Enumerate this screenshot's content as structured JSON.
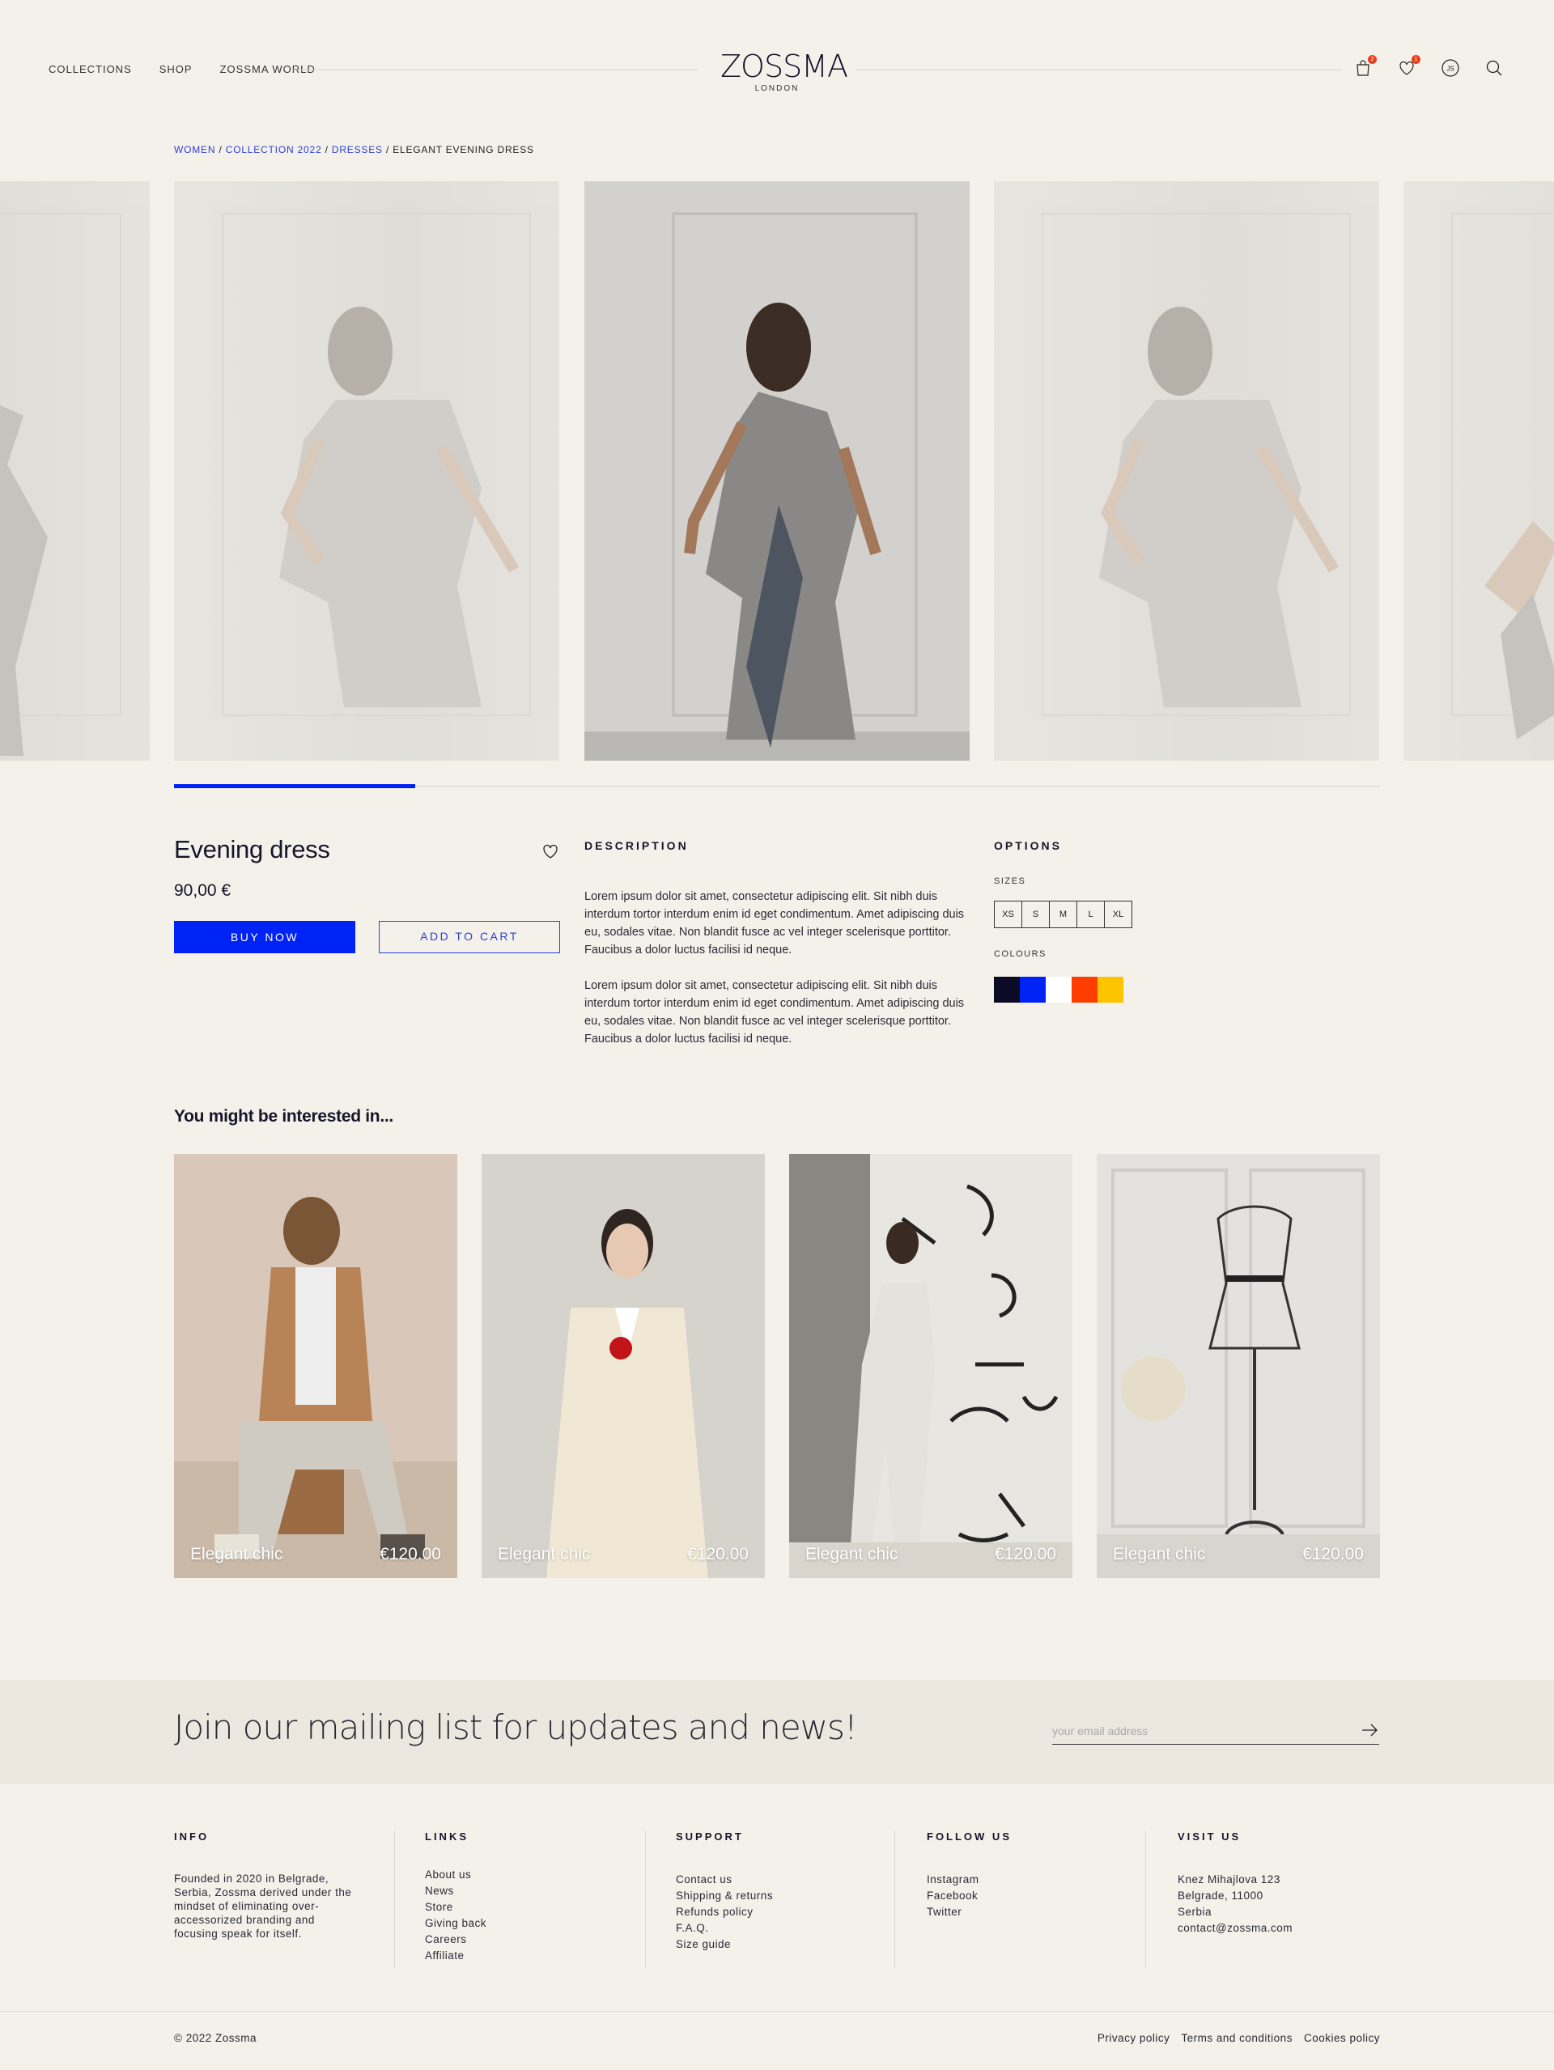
{
  "header": {
    "nav": [
      "COLLECTIONS",
      "SHOP",
      "ZOSSMA WORLD"
    ],
    "logo": {
      "name": "ZOSSMA",
      "city": "LONDON"
    },
    "cart_count": "2",
    "wishlist_count": "1",
    "avatar_initials": "JS"
  },
  "breadcrumb": {
    "women": "WOMEN",
    "collection": "COLLECTION 2022",
    "dresses": "DRESSES",
    "current": "ELEGANT EVENING DRESS",
    "sep": " / "
  },
  "gallery": {
    "progress": 0.2
  },
  "product": {
    "title": "Evening dress",
    "price": "90,00 €",
    "buy_label": "BUY NOW",
    "cart_label": "ADD TO CART"
  },
  "description": {
    "heading": "DESCRIPTION",
    "paragraphs": [
      "Lorem ipsum dolor sit amet, consectetur adipiscing elit. Sit nibh duis interdum tortor interdum enim id eget condimentum. Amet adipiscing duis eu, sodales vitae. Non blandit fusce ac vel integer scelerisque porttitor. Faucibus a dolor luctus facilisi id neque.",
      "Lorem ipsum dolor sit amet, consectetur adipiscing elit. Sit nibh duis interdum tortor interdum enim id eget condimentum. Amet adipiscing duis eu, sodales vitae. Non blandit fusce ac vel integer scelerisque porttitor. Faucibus a dolor luctus facilisi id neque."
    ]
  },
  "options": {
    "heading": "OPTIONS",
    "sizes_label": "SIZES",
    "sizes": [
      "XS",
      "S",
      "M",
      "L",
      "XL"
    ],
    "colours_label": "COLOURS",
    "colours": [
      "#0b0b26",
      "#0023f5",
      "#ffffff",
      "#ff3d00",
      "#ffc400"
    ]
  },
  "recommendations": {
    "title": "You might be interested in...",
    "items": [
      {
        "name": "Elegant chic",
        "price": "€120.00"
      },
      {
        "name": "Elegant chic",
        "price": "€120.00"
      },
      {
        "name": "Elegant chic",
        "price": "€120.00"
      },
      {
        "name": "Elegant chic",
        "price": "€120.00"
      }
    ]
  },
  "newsletter": {
    "heading": "Join our mailing list for updates and news!",
    "placeholder": "your email address"
  },
  "footer": {
    "info": {
      "heading": "INFO",
      "text": "Founded in 2020 in Belgrade, Serbia, Zossma derived under the mindset of eliminating over-accessorized branding and focusing speak for itself."
    },
    "links": {
      "heading": "LINKS",
      "items": [
        "About us",
        "News",
        "Store",
        "Giving back",
        "Careers",
        "Affiliate"
      ]
    },
    "support": {
      "heading": "SUPPORT",
      "items": [
        "Contact us",
        "Shipping & returns",
        "Refunds policy",
        "F.A.Q.",
        "Size guide"
      ]
    },
    "follow": {
      "heading": "FOLLOW US",
      "items": [
        "Instagram",
        "Facebook",
        "Twitter"
      ]
    },
    "visit": {
      "heading": "VISIT US",
      "items": [
        "Knez Mihajlova 123",
        "Belgrade, 11000",
        "Serbia",
        "contact@zossma.com"
      ]
    },
    "copyright": "© 2022  Zossma",
    "legal": [
      "Privacy policy",
      "Terms and conditions",
      "Cookies policy"
    ]
  }
}
